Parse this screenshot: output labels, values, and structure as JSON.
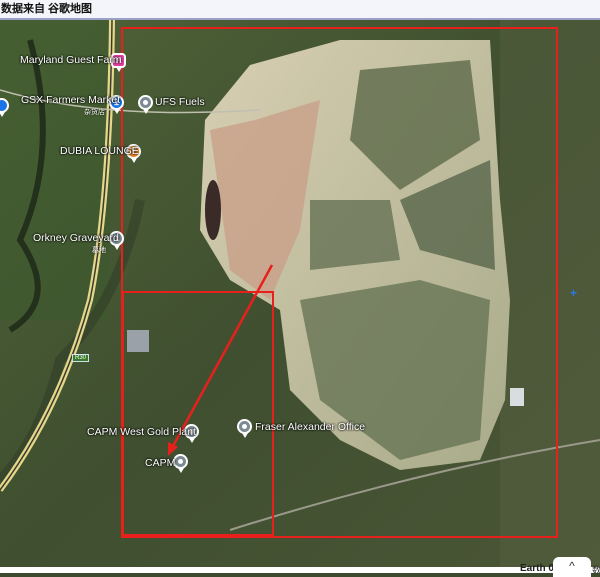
{
  "title": "数据来自 谷歌地图",
  "places": [
    {
      "name": "Maryland Guest Farm",
      "icon": "hotel-icon",
      "color": "#e040a0"
    },
    {
      "name": "GSX Farmers Market",
      "sub": "杂货店",
      "icon": "shopping-cart-icon",
      "color": "#1a73e8"
    },
    {
      "name": "UFS Fuels",
      "icon": "place-icon",
      "color": "#7b8a93"
    },
    {
      "name": "DUBIA LOUNGE",
      "icon": "bar-icon",
      "color": "#f08a24"
    },
    {
      "name": "Orkney Graveyard",
      "sub": "墓地",
      "icon": "cemetery-icon",
      "color": "#7b8a93"
    },
    {
      "name": "CAPM West Gold Plant",
      "icon": "place-icon",
      "color": "#7b8a93"
    },
    {
      "name": "Fraser Alexander Office",
      "icon": "place-icon",
      "color": "#7b8a93"
    },
    {
      "name": "CAPM",
      "icon": "place-icon",
      "color": "#7b8a93"
    }
  ],
  "road_label": "R30",
  "footer": {
    "attribution": "Earth 0",
    "chevron": "^",
    "cut": "数"
  },
  "annotation_color": "#e8201c"
}
